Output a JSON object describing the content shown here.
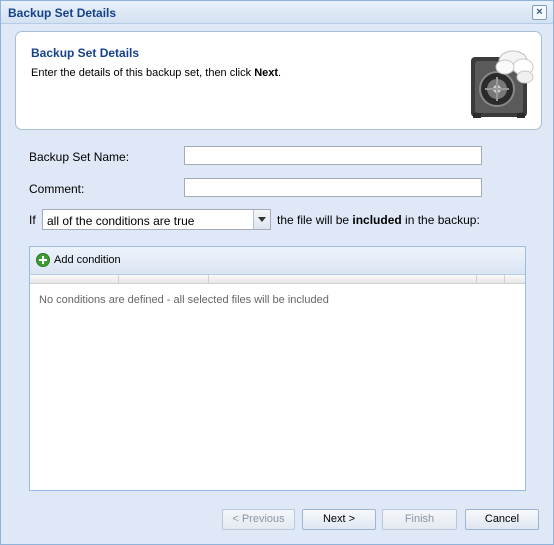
{
  "window": {
    "title": "Backup Set Details"
  },
  "header": {
    "title": "Backup Set Details",
    "desc_prefix": "Enter the details of this backup set, then click ",
    "desc_bold": "Next",
    "desc_suffix": "."
  },
  "form": {
    "name_label": "Backup Set Name:",
    "name_value": "",
    "comment_label": "Comment:",
    "comment_value": "",
    "if_label": "If",
    "condition_mode": "all of the conditions are true",
    "sentence_prefix": "the file will be ",
    "sentence_bold": "included",
    "sentence_suffix": " in the backup:"
  },
  "grid": {
    "add_condition_label": "Add condition",
    "empty_message": "No conditions are defined - all selected files will be included"
  },
  "footer": {
    "previous_label": "< Previous",
    "next_label": "Next >",
    "finish_label": "Finish",
    "cancel_label": "Cancel"
  },
  "icons": {
    "close": "close-icon",
    "safe": "safe-cloud-icon",
    "add": "plus-circle-icon",
    "dropdown": "chevron-down-icon"
  },
  "colors": {
    "title": "#15428b",
    "border": "#99bbe8",
    "add_icon": "#3f9c35"
  }
}
